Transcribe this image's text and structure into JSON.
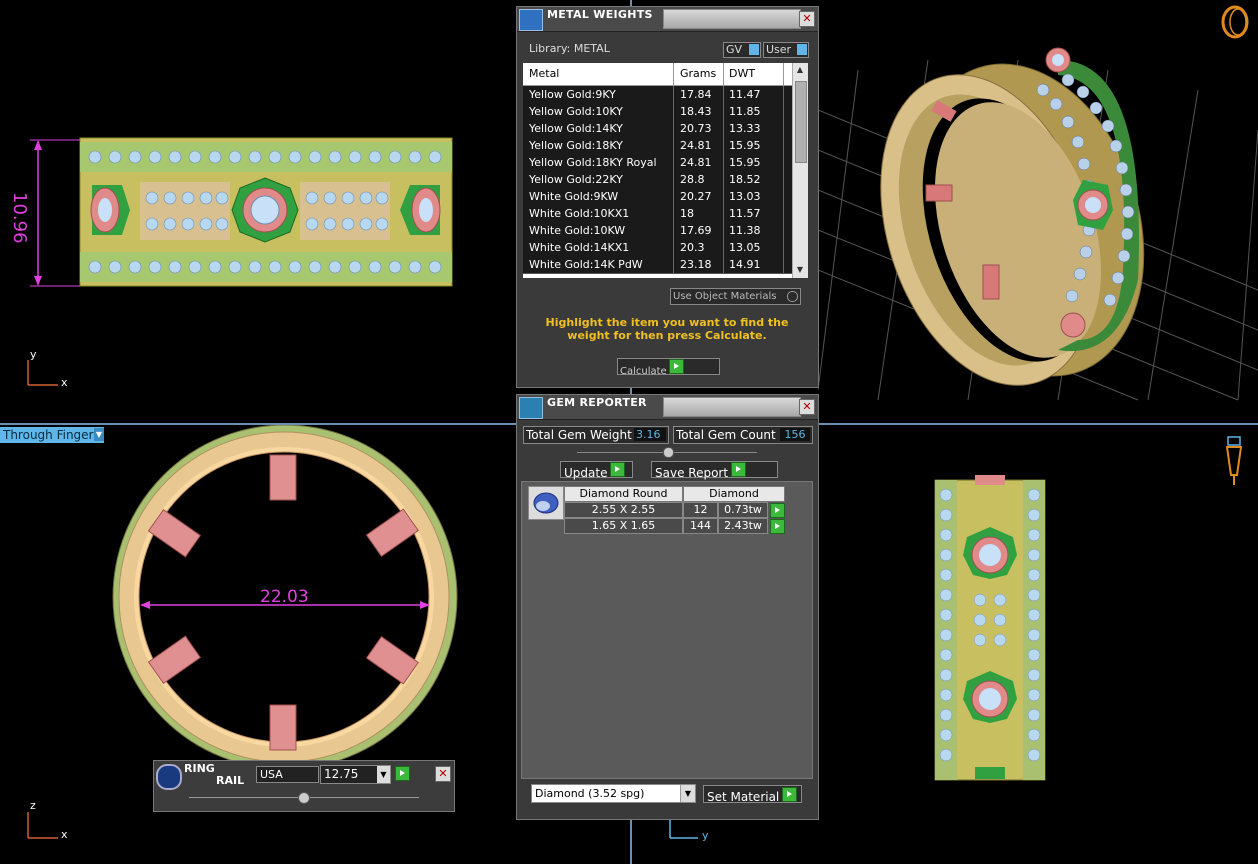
{
  "views": {
    "top_left": {
      "dimension": "10.96",
      "axes": [
        "y",
        "x"
      ]
    },
    "bottom_left": {
      "view_mode": "Through Finger",
      "dimension": "22.03",
      "axes": [
        "z",
        "x"
      ]
    },
    "bottom_mid": {
      "axes": [
        "y"
      ]
    }
  },
  "metal_weights": {
    "title": "METAL WEIGHTS",
    "library_label": "Library: METAL",
    "gv_label": "GV",
    "user_label": "User",
    "columns": [
      "Metal",
      "Grams",
      "DWT"
    ],
    "rows": [
      [
        "Yellow Gold:9KY",
        "17.84",
        "11.47"
      ],
      [
        "Yellow Gold:10KY",
        "18.43",
        "11.85"
      ],
      [
        "Yellow Gold:14KY",
        "20.73",
        "13.33"
      ],
      [
        "Yellow Gold:18KY",
        "24.81",
        "15.95"
      ],
      [
        "Yellow Gold:18KY Royal",
        "24.81",
        "15.95"
      ],
      [
        "Yellow Gold:22KY",
        "28.8",
        "18.52"
      ],
      [
        "White Gold:9KW",
        "20.27",
        "13.03"
      ],
      [
        "White Gold:10KX1",
        "18",
        "11.57"
      ],
      [
        "White Gold:10KW",
        "17.69",
        "11.38"
      ],
      [
        "White Gold:14KX1",
        "20.3",
        "13.05"
      ],
      [
        "White Gold:14K PdW",
        "23.18",
        "14.91"
      ]
    ],
    "use_object_materials": "Use Object Materials",
    "instruction": "Highlight the item you want to find the weight for then press Calculate.",
    "calculate_label": "Calculate"
  },
  "gem_reporter": {
    "title": "GEM REPORTER",
    "total_weight_label": "Total Gem Weight",
    "total_weight_value": "3.16",
    "total_count_label": "Total Gem Count",
    "total_count_value": "156",
    "update_label": "Update",
    "save_report_label": "Save Report",
    "header_shape": "Diamond Round",
    "header_material": "Diamond",
    "gems": [
      {
        "size": "2.55 X 2.55",
        "count": "12",
        "weight": "0.73tw"
      },
      {
        "size": "1.65 X 1.65",
        "count": "144",
        "weight": "2.43tw"
      }
    ],
    "material_select": "Diamond     (3.52 spg)",
    "set_material_label": "Set Material"
  },
  "ring_rail": {
    "title_line1": "RING",
    "title_line2": "RAIL",
    "region": "USA",
    "size": "12.75"
  },
  "colors": {
    "accent_blue": "#5fb6e8",
    "dimension_magenta": "#e040e0",
    "instruction_yellow": "#f0c020",
    "axis_orange": "#d06030",
    "gold": "#c8b060"
  }
}
